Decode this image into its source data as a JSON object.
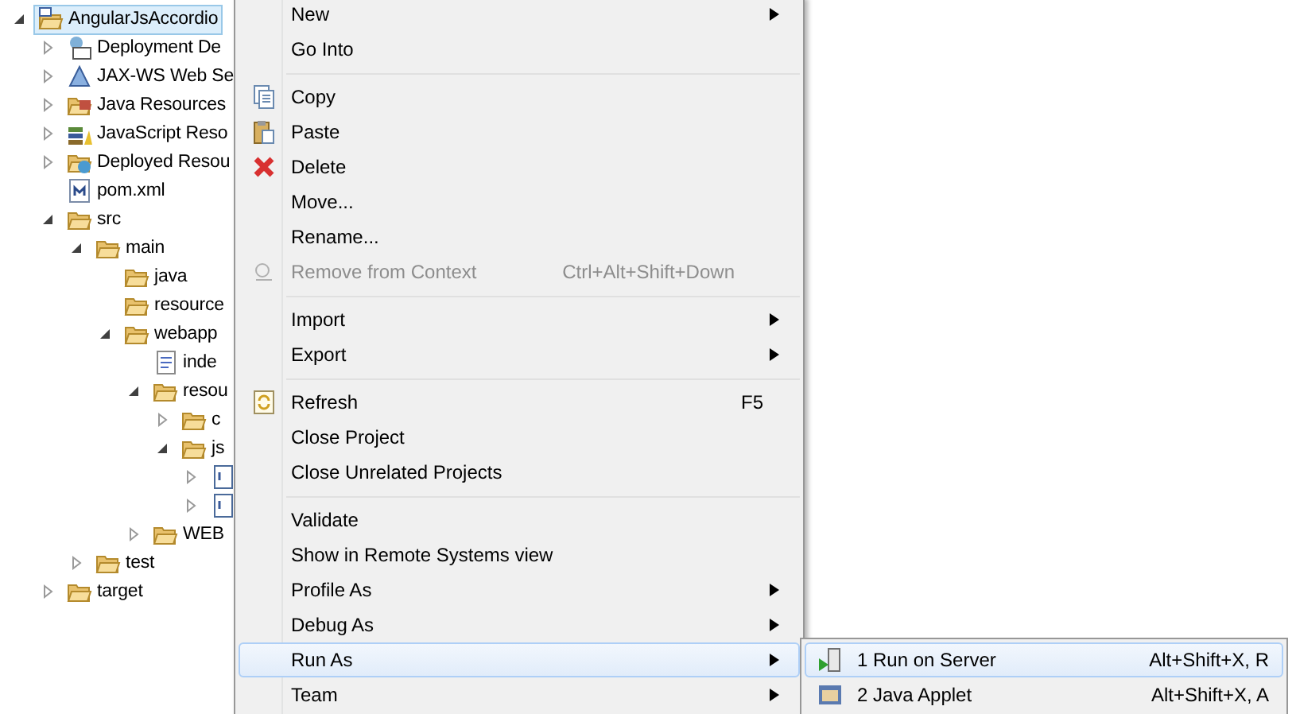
{
  "tree": [
    {
      "label": "AngularJsAccordio",
      "kind": "project",
      "expanded": true,
      "selected": true,
      "children": [
        {
          "label": "Deployment De",
          "kind": "deployment",
          "expanded": false,
          "selected": false
        },
        {
          "label": "JAX-WS Web Se",
          "kind": "webservice",
          "expanded": false,
          "selected": false
        },
        {
          "label": "Java Resources",
          "kind": "java-resources",
          "expanded": false,
          "selected": false
        },
        {
          "label": "JavaScript Reso",
          "kind": "javascript",
          "expanded": false,
          "selected": false
        },
        {
          "label": "Deployed Resou",
          "kind": "deployed",
          "expanded": false,
          "selected": false
        },
        {
          "label": "pom.xml",
          "kind": "maven-file",
          "selected": false
        },
        {
          "label": "src",
          "kind": "folder",
          "expanded": true,
          "selected": false,
          "children": [
            {
              "label": "main",
              "kind": "folder",
              "expanded": true,
              "selected": false,
              "children": [
                {
                  "label": "java",
                  "kind": "folder",
                  "selected": false
                },
                {
                  "label": "resource",
                  "kind": "folder",
                  "selected": false
                },
                {
                  "label": "webapp",
                  "kind": "folder",
                  "expanded": true,
                  "selected": false,
                  "children": [
                    {
                      "label": "inde",
                      "kind": "html-file",
                      "selected": false
                    },
                    {
                      "label": "resou",
                      "kind": "folder",
                      "expanded": true,
                      "selected": false,
                      "children": [
                        {
                          "label": "c",
                          "kind": "folder",
                          "expanded": false,
                          "selected": false
                        },
                        {
                          "label": "js",
                          "kind": "folder",
                          "expanded": true,
                          "selected": false,
                          "children": [
                            {
                              "kind": "js-file",
                              "expanded": false,
                              "selected": false
                            },
                            {
                              "kind": "js-file",
                              "expanded": false,
                              "selected": false
                            }
                          ]
                        }
                      ]
                    },
                    {
                      "label": "WEB",
                      "kind": "folder",
                      "expanded": false,
                      "selected": false
                    }
                  ]
                }
              ]
            },
            {
              "label": "test",
              "kind": "folder",
              "expanded": false,
              "selected": false
            }
          ]
        },
        {
          "label": "target",
          "kind": "folder",
          "expanded": false,
          "selected": false
        }
      ]
    }
  ],
  "context_menu": [
    {
      "kind": "item",
      "label": "New",
      "submenu": true,
      "disabled": false,
      "selected": false
    },
    {
      "kind": "item",
      "label": "Go Into",
      "disabled": false,
      "selected": false
    },
    {
      "kind": "separator"
    },
    {
      "kind": "copy",
      "label": "Copy",
      "disabled": false,
      "selected": false
    },
    {
      "kind": "paste",
      "label": "Paste",
      "disabled": false,
      "selected": false
    },
    {
      "kind": "delete",
      "label": "Delete",
      "disabled": false,
      "selected": false
    },
    {
      "kind": "item",
      "label": "Move...",
      "disabled": false,
      "selected": false
    },
    {
      "kind": "item",
      "label": "Rename...",
      "disabled": false,
      "selected": false
    },
    {
      "kind": "context",
      "label": "Remove from Context",
      "shortcut": "Ctrl+Alt+Shift+Down",
      "disabled": true,
      "selected": false
    },
    {
      "kind": "separator"
    },
    {
      "kind": "item",
      "label": "Import",
      "submenu": true,
      "disabled": false,
      "selected": false
    },
    {
      "kind": "item",
      "label": "Export",
      "submenu": true,
      "disabled": false,
      "selected": false
    },
    {
      "kind": "separator"
    },
    {
      "kind": "refresh",
      "label": "Refresh",
      "shortcut": "F5",
      "disabled": false,
      "selected": false
    },
    {
      "kind": "item",
      "label": "Close Project",
      "disabled": false,
      "selected": false
    },
    {
      "kind": "item",
      "label": "Close Unrelated Projects",
      "disabled": false,
      "selected": false
    },
    {
      "kind": "separator"
    },
    {
      "kind": "item",
      "label": "Validate",
      "disabled": false,
      "selected": false
    },
    {
      "kind": "item",
      "label": "Show in Remote Systems view",
      "disabled": false,
      "selected": false
    },
    {
      "kind": "item",
      "label": "Profile As",
      "submenu": true,
      "disabled": false,
      "selected": false
    },
    {
      "kind": "item",
      "label": "Debug As",
      "submenu": true,
      "disabled": false,
      "selected": false
    },
    {
      "kind": "item",
      "label": "Run As",
      "submenu": true,
      "disabled": false,
      "selected": true
    },
    {
      "kind": "item",
      "label": "Team",
      "submenu": true,
      "disabled": false,
      "selected": false
    }
  ],
  "run_as_submenu": [
    {
      "kind": "server",
      "label": "1 Run on Server",
      "shortcut": "Alt+Shift+X, R",
      "selected": true
    },
    {
      "kind": "applet",
      "label": "2 Java Applet",
      "shortcut": "Alt+Shift+X, A",
      "selected": false
    }
  ]
}
